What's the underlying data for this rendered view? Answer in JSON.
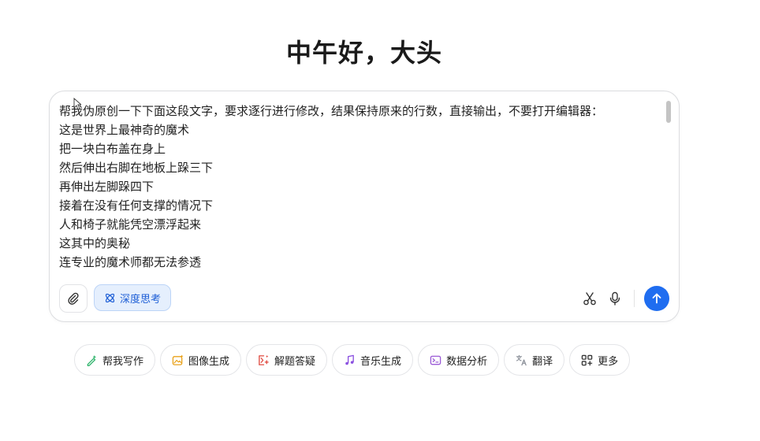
{
  "greeting": "中午好，大头",
  "composer": {
    "lines": [
      "帮我伪原创一下下面这段文字，要求逐行进行修改，结果保持原来的行数，直接输出，不要打开编辑器：",
      "这是世界上最神奇的魔术",
      "把一块白布盖在身上",
      "然后伸出右脚在地板上跺三下",
      "再伸出左脚跺四下",
      "接着在没有任何支撑的情况下",
      "人和椅子就能凭空漂浮起来",
      "这其中的奥秘",
      "连专业的魔术师都无法参透"
    ],
    "deep_think_label": "深度思考"
  },
  "chips": [
    {
      "label": "帮我写作",
      "icon": "pen-sparkle-icon",
      "color": "#2db36a"
    },
    {
      "label": "图像生成",
      "icon": "image-sparkle-icon",
      "color": "#e9a21b"
    },
    {
      "label": "解题答疑",
      "icon": "math-icon",
      "color": "#e0483e"
    },
    {
      "label": "音乐生成",
      "icon": "music-note-icon",
      "color": "#8a4fe0"
    },
    {
      "label": "数据分析",
      "icon": "terminal-icon",
      "color": "#9b5bd6"
    },
    {
      "label": "翻译",
      "icon": "translate-icon",
      "color": "#8a8f98"
    },
    {
      "label": "更多",
      "icon": "grid-plus-icon",
      "color": "#333333"
    }
  ],
  "colors": {
    "accent": "#1f6df0",
    "deep_think_bg": "#e5effd"
  }
}
